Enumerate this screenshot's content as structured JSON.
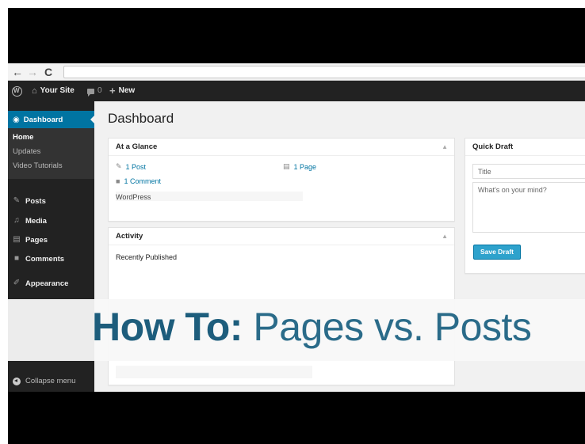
{
  "browser": {
    "back": "←",
    "forward": "→",
    "reload": "C",
    "url": ""
  },
  "adminbar": {
    "site_name": "Your Site",
    "comment_count": "0",
    "new_label": "New"
  },
  "sidebar": {
    "current": "Dashboard",
    "submenu": [
      "Home",
      "Updates",
      "Video Tutorials"
    ],
    "items": [
      {
        "label": "Posts",
        "icon": "pin-icon"
      },
      {
        "label": "Media",
        "icon": "media-icon"
      },
      {
        "label": "Pages",
        "icon": "pages-icon"
      },
      {
        "label": "Comments",
        "icon": "comment-icon"
      },
      {
        "label": "Appearance",
        "icon": "brush-icon"
      }
    ],
    "collapse": "Collapse menu"
  },
  "main": {
    "title": "Dashboard",
    "glance": {
      "title": "At a Glance",
      "posts": "1 Post",
      "pages": "1 Page",
      "comments": "1 Comment",
      "footer": "WordPress"
    },
    "activity": {
      "title": "Activity",
      "recently": "Recently Published"
    },
    "quick_draft": {
      "title": "Quick Draft",
      "title_placeholder": "Title",
      "content_placeholder": "What's on your mind?",
      "save": "Save Draft"
    }
  },
  "banner": {
    "bold": "How To:",
    "light": " Pages vs. Posts"
  },
  "colors": {
    "accent": "#0074a2",
    "admin_bg": "#222222",
    "banner_text": "#1d5d7c",
    "button": "#2ea2cc"
  }
}
